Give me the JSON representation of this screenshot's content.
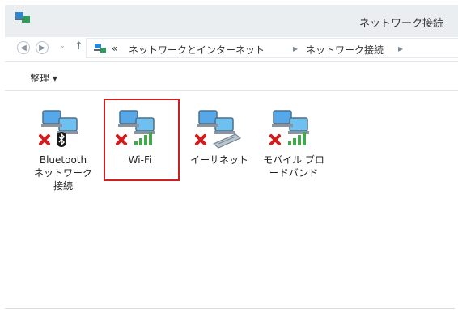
{
  "window": {
    "title": "ネットワーク接続"
  },
  "navigation": {
    "back_icon": "left-arrow-icon",
    "forward_icon": "right-arrow-icon",
    "up_icon": "up-arrow-icon",
    "breadcrumb": [
      "«",
      "ネットワークとインターネット",
      "ネットワーク接続"
    ],
    "separator": "▸"
  },
  "toolbar": {
    "organize_label": "整理 ▾"
  },
  "connections": [
    {
      "label": "Bluetooth\nネットワーク\n接続",
      "type": "bluetooth-icon"
    },
    {
      "label": "Wi-Fi",
      "type": "wifi-signal-icon"
    },
    {
      "label": "イーサネット",
      "type": "ethernet-icon"
    },
    {
      "label": "モバイル ブロ\nードバンド",
      "type": "mobile-broadband-icon"
    }
  ],
  "selected_connection": "Wi-Fi"
}
